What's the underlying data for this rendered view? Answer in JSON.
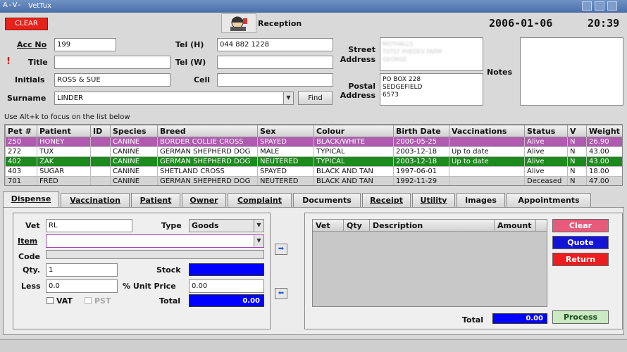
{
  "window": {
    "title": "VetTux",
    "system_glyphs": "A-V-"
  },
  "header": {
    "clear_label": "CLEAR",
    "section": "Reception",
    "date": "2006-01-06",
    "time": "20:39"
  },
  "owner": {
    "acc_no_label": "Acc No",
    "acc_no": "199",
    "title_label": "Title",
    "title": "",
    "initials_label": "Initials",
    "initials": "ROSS & SUE",
    "surname_label": "Surname",
    "surname": "LINDER",
    "find_label": "Find",
    "tel_h_label": "Tel (H)",
    "tel_h": "044 882 1228",
    "tel_w_label": "Tel (W)",
    "tel_w": "",
    "cell_label": "Cell",
    "cell": "",
    "street_label": "Street",
    "street_label2": "Address",
    "street_lines": [
      "MOTHALLS",
      "TSTST PHEDEV FARM",
      "GEORGE"
    ],
    "postal_label": "Postal",
    "postal_label2": "Address",
    "postal_lines": [
      "PO BOX 228",
      "SEDGEFIELD",
      "6573"
    ],
    "notes_label": "Notes",
    "notes": "",
    "required_mark": "!"
  },
  "list_hint": "Use Alt+k to focus on the list below",
  "pets": {
    "columns": [
      "Pet #",
      "Patient",
      "ID",
      "Species",
      "Breed",
      "Sex",
      "Colour",
      "Birth Date",
      "Vaccinations",
      "Status",
      "V",
      "Weight"
    ],
    "rows": [
      {
        "cells": [
          "250",
          "HONEY",
          "",
          "CANINE",
          "BORDER COLLIE CROSS",
          "SPAYED",
          "BLACK/WHITE",
          "2000-05-25",
          "",
          "Alive",
          "N",
          "26.90"
        ],
        "style": "sel-pink"
      },
      {
        "cells": [
          "272",
          "TUX",
          "",
          "CANINE",
          "GERMAN SHEPHERD DOG",
          "MALE",
          "TYPICAL",
          "2003-12-18",
          "Up to date",
          "Alive",
          "N",
          "43.00"
        ],
        "style": "white"
      },
      {
        "cells": [
          "402",
          "ZAK",
          "",
          "CANINE",
          "GERMAN SHEPHERD DOG",
          "NEUTERED",
          "TYPICAL",
          "2003-12-18",
          "Up to date",
          "Alive",
          "N",
          "43.00"
        ],
        "style": "green"
      },
      {
        "cells": [
          "403",
          "SUGAR",
          "",
          "CANINE",
          "SHETLAND CROSS",
          "SPAYED",
          "BLACK AND TAN",
          "1997-06-01",
          "",
          "Alive",
          "N",
          "18.00"
        ],
        "style": "white"
      },
      {
        "cells": [
          "701",
          "FRED",
          "",
          "CANINE",
          "GERMAN SHEPHERD DOG",
          "NEUTERED",
          "BLACK AND TAN",
          "1992-11-29",
          "",
          "Deceased",
          "N",
          "47.00"
        ],
        "style": "grey"
      }
    ]
  },
  "tabs": [
    {
      "label": "Dispense",
      "active": true
    },
    {
      "label": "Vaccination"
    },
    {
      "label": "Patient"
    },
    {
      "label": "Owner"
    },
    {
      "label": "Complaint"
    },
    {
      "label": "Documents"
    },
    {
      "label": "Receipt"
    },
    {
      "label": "Utility"
    },
    {
      "label": "Images"
    },
    {
      "label": "Appointments"
    }
  ],
  "dispense": {
    "vet_label": "Vet",
    "vet": "RL",
    "type_label": "Type",
    "type": "Goods",
    "item_label": "Item",
    "item": "",
    "code_label": "Code",
    "code": "",
    "qty_label": "Qty.",
    "qty": "1",
    "stock_label": "Stock",
    "stock": "",
    "less_label": "Less",
    "less": "0.0",
    "unit_price_label": "% Unit Price",
    "unit_price": "0.00",
    "vat_label": "VAT",
    "pst_label": "PST",
    "total_label": "Total",
    "total": "0.00"
  },
  "invoice": {
    "columns": [
      "Vet",
      "Qty",
      "Description",
      "Amount"
    ],
    "total_label": "Total",
    "total": "0.00",
    "clear_label": "Clear",
    "quote_label": "Quote",
    "return_label": "Return",
    "process_label": "Process"
  },
  "colors": {
    "sel_pink": "#b05ab0",
    "green_row": "#1d8a1d",
    "blue_field": "#0000ff",
    "clear_red": "#e5231b",
    "clear_pink": "#e85a7a",
    "quote_blue": "#1414d6",
    "return_red": "#ee1c1c",
    "process_green": "#c9eac2"
  }
}
